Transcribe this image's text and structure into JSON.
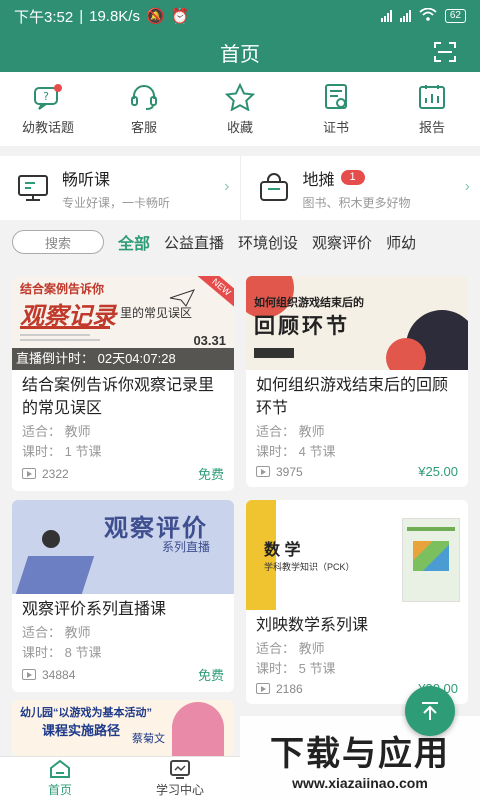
{
  "status": {
    "time": "下午3:52",
    "speed": "19.8K/s",
    "battery": "62"
  },
  "nav": {
    "title": "首页"
  },
  "quick": [
    {
      "label": "幼教话题",
      "icon": "chat-question-icon"
    },
    {
      "label": "客服",
      "icon": "headset-icon"
    },
    {
      "label": "收藏",
      "icon": "star-icon"
    },
    {
      "label": "证书",
      "icon": "certificate-icon"
    },
    {
      "label": "报告",
      "icon": "report-chart-icon"
    }
  ],
  "promo": [
    {
      "title": "畅听课",
      "sub": "专业好课，一卡畅听",
      "badge": ""
    },
    {
      "title": "地摊",
      "sub": "图书、积木更多好物",
      "badge": "1"
    }
  ],
  "search": {
    "placeholder": "搜索"
  },
  "categories": [
    "全部",
    "公益直播",
    "环境创设",
    "观察评价",
    "师幼"
  ],
  "courses": [
    {
      "cover_line1": "结合案例告诉你",
      "cover_line2": "观察记录",
      "cover_line3": "里的常见误区",
      "cover_date": "03.31",
      "countdown": "直播倒计时：  02天04:07:28",
      "name": "结合案例告诉你观察记录里的常见误区",
      "audience": "适合：  教师",
      "lessons": "课时：  1 节课",
      "views": "2322",
      "price": "免费",
      "accent": "#c0392b"
    },
    {
      "cover_line1": "如何组织游戏结束后的",
      "cover_line2": "回顾环节",
      "name": "如何组织游戏结束后的回顾环节",
      "audience": "适合：  教师",
      "lessons": "课时：  4 节课",
      "views": "3975",
      "price": "¥25.00",
      "accent": "#222222"
    },
    {
      "cover_line1": "观察评价",
      "cover_line2": "系列直播",
      "name": "观察评价系列直播课",
      "audience": "适合：  教师",
      "lessons": "课时：  8 节课",
      "views": "34884",
      "price": "免费",
      "accent": "#5b6fb0"
    },
    {
      "cover_line1": "数 学",
      "cover_line2": "学科教学知识（PCK）",
      "name": "刘映数学系列课",
      "audience": "适合：  教师",
      "lessons": "课时：  5 节课",
      "views": "2186",
      "price": "¥30.00",
      "accent": "#f0c330"
    }
  ],
  "next": {
    "cover_line1": "幼儿园“以游戏为基本活动”",
    "cover_line2": "课程实施路径",
    "teacher": "蔡菊文"
  },
  "watermark": {
    "line1": "下载与应用",
    "line2": "www.xiazaiinao.com"
  },
  "tabs": [
    {
      "label": "首页",
      "icon": "home-icon"
    },
    {
      "label": "学习中心",
      "icon": "study-center-icon"
    }
  ],
  "colors": {
    "brand": "#2f8f72",
    "accent_green": "#2f9c78",
    "badge_red": "#e74c4c"
  }
}
